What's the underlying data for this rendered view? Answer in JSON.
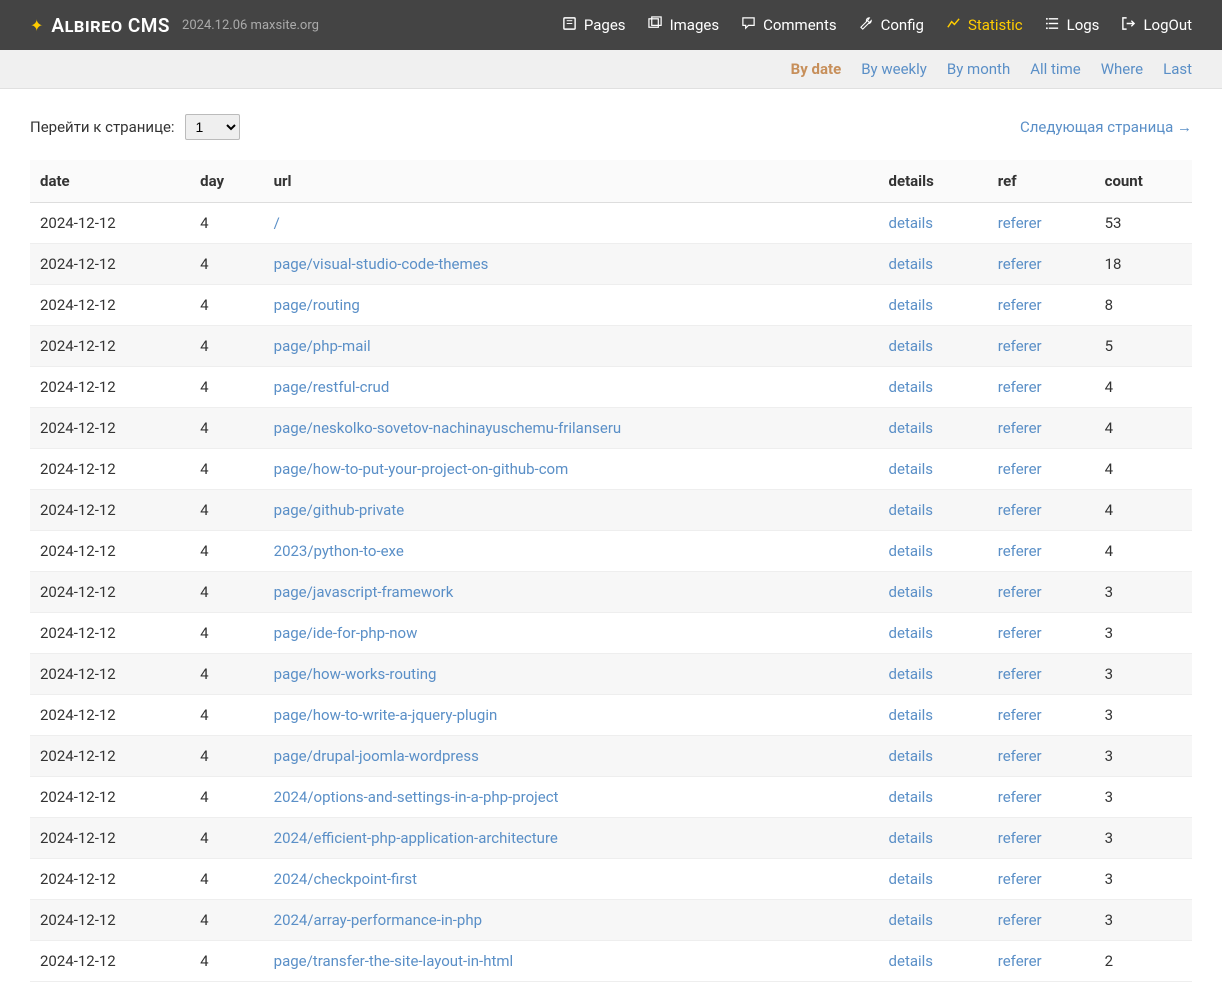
{
  "brand": {
    "name": "Albireo CMS",
    "meta": "2024.12.06 maxsite.org"
  },
  "topnav": [
    {
      "id": "pages",
      "label": "Pages",
      "icon": "book-icon"
    },
    {
      "id": "images",
      "label": "Images",
      "icon": "images-icon"
    },
    {
      "id": "comments",
      "label": "Comments",
      "icon": "comments-icon"
    },
    {
      "id": "config",
      "label": "Config",
      "icon": "wrench-icon"
    },
    {
      "id": "statistic",
      "label": "Statistic",
      "icon": "chart-icon",
      "active": true
    },
    {
      "id": "logs",
      "label": "Logs",
      "icon": "list-icon"
    },
    {
      "id": "logout",
      "label": "LogOut",
      "icon": "logout-icon"
    }
  ],
  "subnav": [
    {
      "id": "bydate",
      "label": "By date",
      "active": true
    },
    {
      "id": "byweekly",
      "label": "By weekly"
    },
    {
      "id": "bymonth",
      "label": "By month"
    },
    {
      "id": "alltime",
      "label": "All time"
    },
    {
      "id": "where",
      "label": "Where"
    },
    {
      "id": "last",
      "label": "Last"
    }
  ],
  "pager": {
    "label": "Перейти к странице:",
    "current": "1",
    "next_label": "Следующая страница →"
  },
  "table": {
    "headers": {
      "date": "date",
      "day": "day",
      "url": "url",
      "details": "details",
      "ref": "ref",
      "count": "count"
    },
    "details_label": "details",
    "ref_label": "referer",
    "rows": [
      {
        "date": "2024-12-12",
        "day": "4",
        "url": "/",
        "count": "53"
      },
      {
        "date": "2024-12-12",
        "day": "4",
        "url": "page/visual-studio-code-themes",
        "count": "18"
      },
      {
        "date": "2024-12-12",
        "day": "4",
        "url": "page/routing",
        "count": "8"
      },
      {
        "date": "2024-12-12",
        "day": "4",
        "url": "page/php-mail",
        "count": "5"
      },
      {
        "date": "2024-12-12",
        "day": "4",
        "url": "page/restful-crud",
        "count": "4"
      },
      {
        "date": "2024-12-12",
        "day": "4",
        "url": "page/neskolko-sovetov-nachinayuschemu-frilanseru",
        "count": "4"
      },
      {
        "date": "2024-12-12",
        "day": "4",
        "url": "page/how-to-put-your-project-on-github-com",
        "count": "4"
      },
      {
        "date": "2024-12-12",
        "day": "4",
        "url": "page/github-private",
        "count": "4"
      },
      {
        "date": "2024-12-12",
        "day": "4",
        "url": "2023/python-to-exe",
        "count": "4"
      },
      {
        "date": "2024-12-12",
        "day": "4",
        "url": "page/javascript-framework",
        "count": "3"
      },
      {
        "date": "2024-12-12",
        "day": "4",
        "url": "page/ide-for-php-now",
        "count": "3"
      },
      {
        "date": "2024-12-12",
        "day": "4",
        "url": "page/how-works-routing",
        "count": "3"
      },
      {
        "date": "2024-12-12",
        "day": "4",
        "url": "page/how-to-write-a-jquery-plugin",
        "count": "3"
      },
      {
        "date": "2024-12-12",
        "day": "4",
        "url": "page/drupal-joomla-wordpress",
        "count": "3"
      },
      {
        "date": "2024-12-12",
        "day": "4",
        "url": "2024/options-and-settings-in-a-php-project",
        "count": "3"
      },
      {
        "date": "2024-12-12",
        "day": "4",
        "url": "2024/efficient-php-application-architecture",
        "count": "3"
      },
      {
        "date": "2024-12-12",
        "day": "4",
        "url": "2024/checkpoint-first",
        "count": "3"
      },
      {
        "date": "2024-12-12",
        "day": "4",
        "url": "2024/array-performance-in-php",
        "count": "3"
      },
      {
        "date": "2024-12-12",
        "day": "4",
        "url": "page/transfer-the-site-layout-in-html",
        "count": "2"
      }
    ]
  }
}
